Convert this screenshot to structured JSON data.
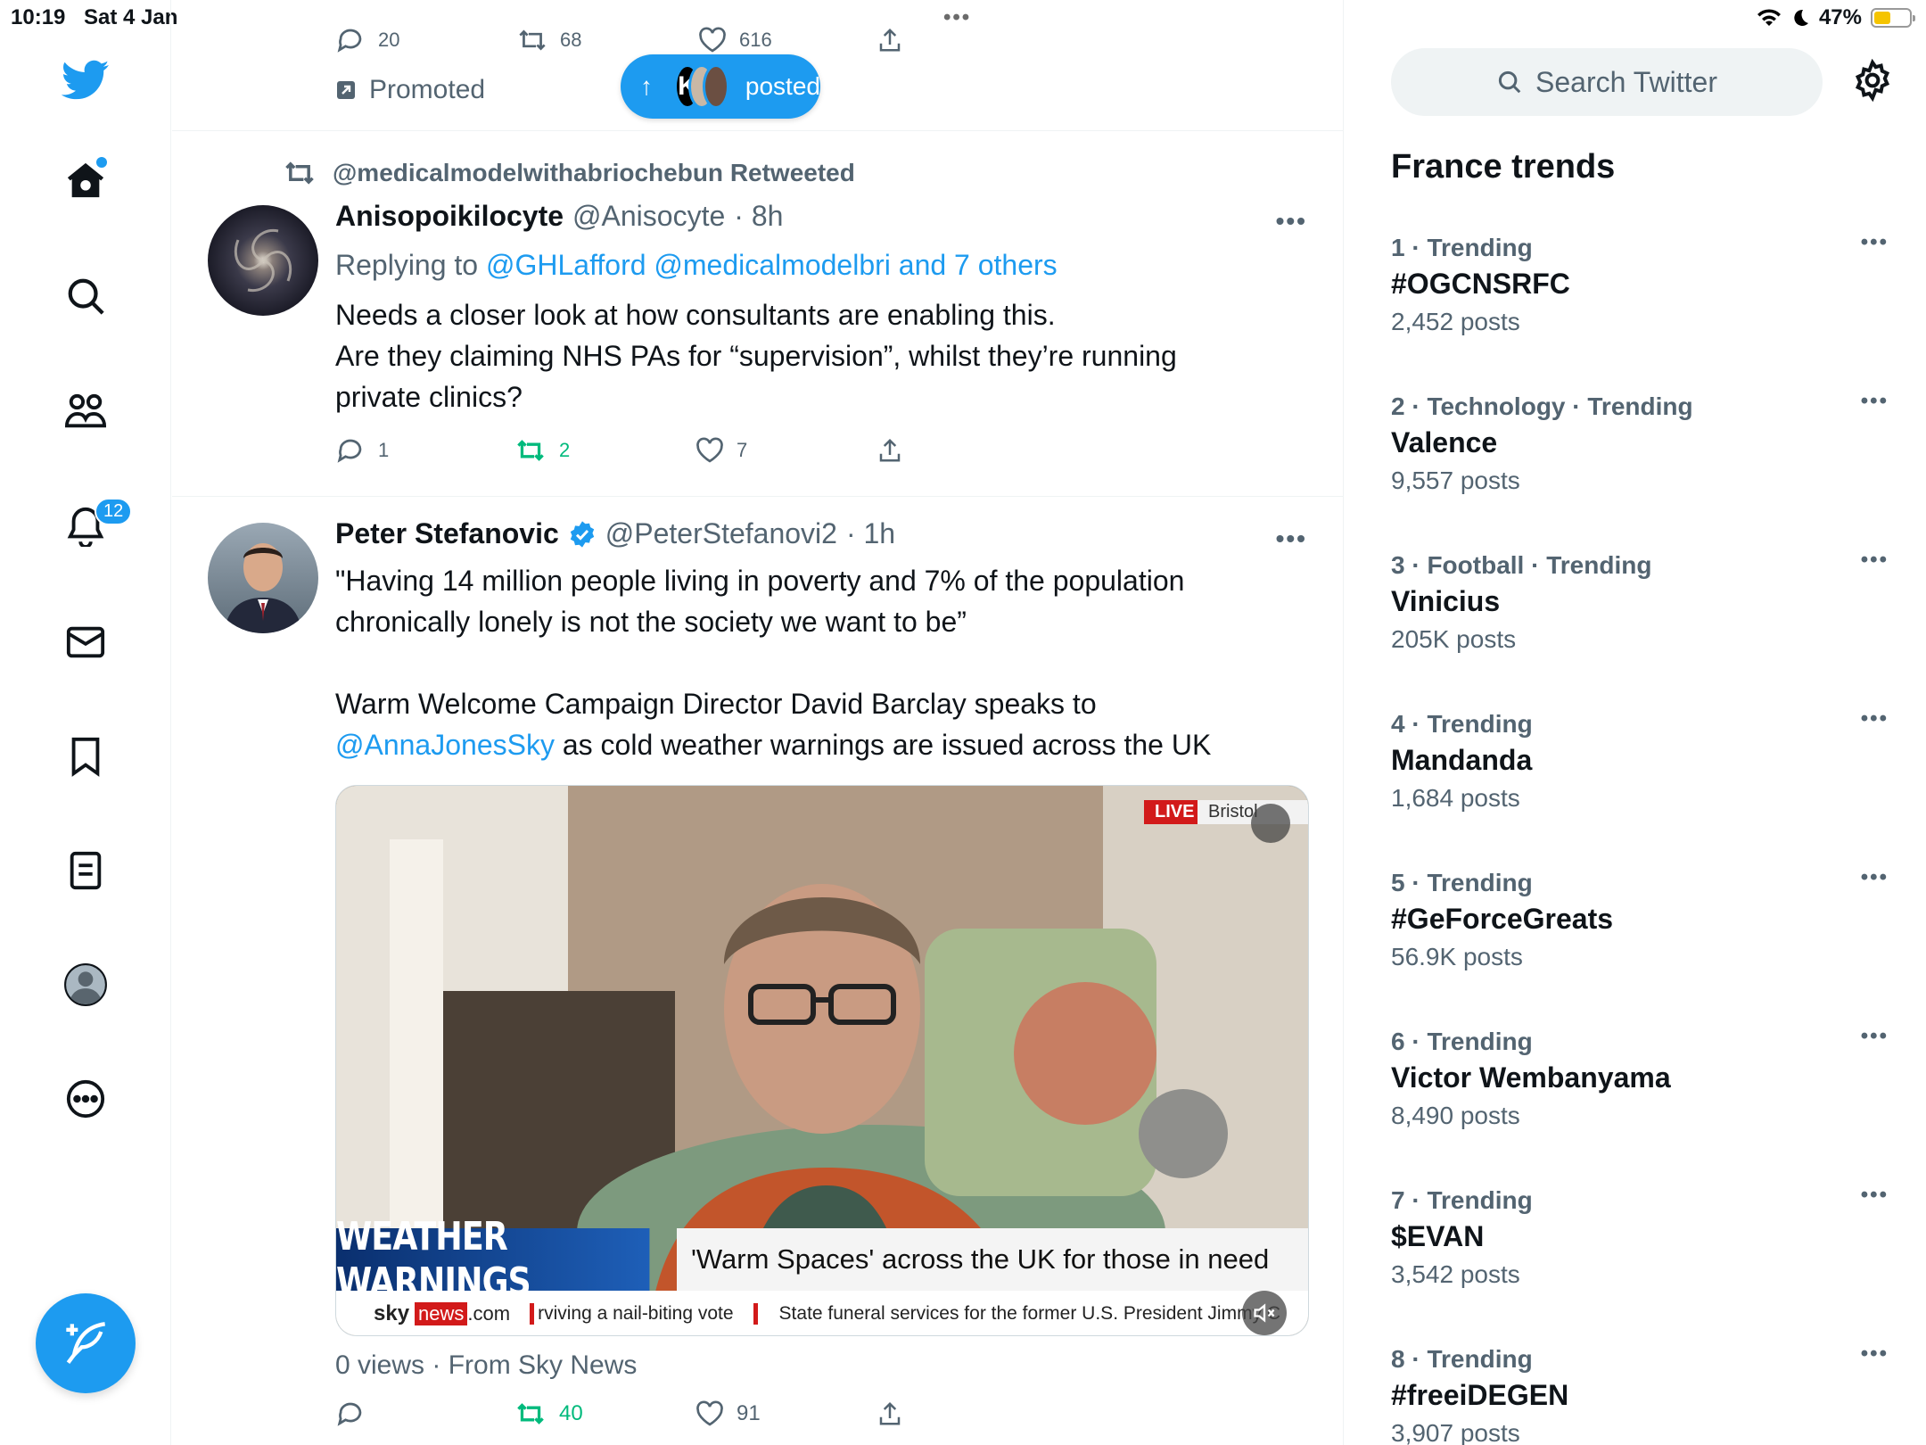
{
  "status_bar": {
    "time": "10:19",
    "date": "Sat 4 Jan",
    "battery": "47%",
    "dots": "•••",
    "battery_level": 0.47
  },
  "nav": {
    "items": [
      "home",
      "explore",
      "communities",
      "notifications",
      "messages",
      "bookmarks",
      "lists",
      "profile",
      "more"
    ],
    "notifications_count": "12"
  },
  "top_tweet": {
    "replies": "20",
    "retweets": "68",
    "likes": "616",
    "promoted": "Promoted"
  },
  "new_posts_pill": {
    "arrow": "↑",
    "avatar_letter": "K",
    "label": "posted"
  },
  "tweet1": {
    "retweeted_by": "@medicalmodelwithabriochebun Retweeted",
    "name": "Anisopoikilocyte",
    "handle": "@Anisocyte",
    "time": "· 8h",
    "reply_prefix": "Replying to ",
    "reply_to": "@GHLafford @medicalmodelbri and 7 others",
    "text_line1": "Needs a closer look at how consultants are enabling this.",
    "text_line2": "Are they claiming NHS PAs for “supervision”, whilst they’re running private clinics?",
    "replies": "1",
    "retweets": "2",
    "likes": "7",
    "more": "•••"
  },
  "tweet2": {
    "name": "Peter Stefanovic",
    "handle": "@PeterStefanovi2",
    "time": "· 1h",
    "text_para1": "\"Having 14 million people living in poverty and 7% of the population chronically lonely is not the society we want to be”",
    "text_para2_prefix": "Warm Welcome Campaign Director David Barclay speaks to ",
    "mention": "@AnnaJonesSky",
    "text_para2_suffix": " as cold weather warnings are issued across the UK",
    "more": "•••",
    "media": {
      "live": "LIVE",
      "location": "Bristol",
      "banner": "WEATHER WARNINGS",
      "headline": "'Warm Spaces' across the UK for those in need",
      "brand_sky": "sky",
      "brand_news": "news",
      "brand_com": ".com",
      "ticker1": "rviving a nail-biting vote",
      "ticker2": "State funeral services for the former U.S. President Jimmy C"
    },
    "views": "0 views · From Sky News",
    "retweets": "40",
    "likes": "91"
  },
  "right": {
    "search_placeholder": "Search Twitter",
    "title": "France trends",
    "trends": [
      {
        "context": "1 · Trending",
        "name": "#OGCNSRFC",
        "count": "2,452 posts"
      },
      {
        "context": "2 · Technology · Trending",
        "name": "Valence",
        "count": "9,557 posts"
      },
      {
        "context": "3 · Football · Trending",
        "name": "Vinicius",
        "count": "205K posts"
      },
      {
        "context": "4 · Trending",
        "name": "Mandanda",
        "count": "1,684 posts"
      },
      {
        "context": "5 · Trending",
        "name": "#GeForceGreats",
        "count": "56.9K posts"
      },
      {
        "context": "6 · Trending",
        "name": "Victor Wembanyama",
        "count": "8,490 posts"
      },
      {
        "context": "7 · Trending",
        "name": "$EVAN",
        "count": "3,542 posts"
      },
      {
        "context": "8 · Trending",
        "name": "#freeiDEGEN",
        "count": "3,907 posts"
      }
    ],
    "trend_more": "•••"
  },
  "colors": {
    "accent": "#1d9bf0",
    "retweet_green": "#00ba7c",
    "muted": "#536471"
  }
}
